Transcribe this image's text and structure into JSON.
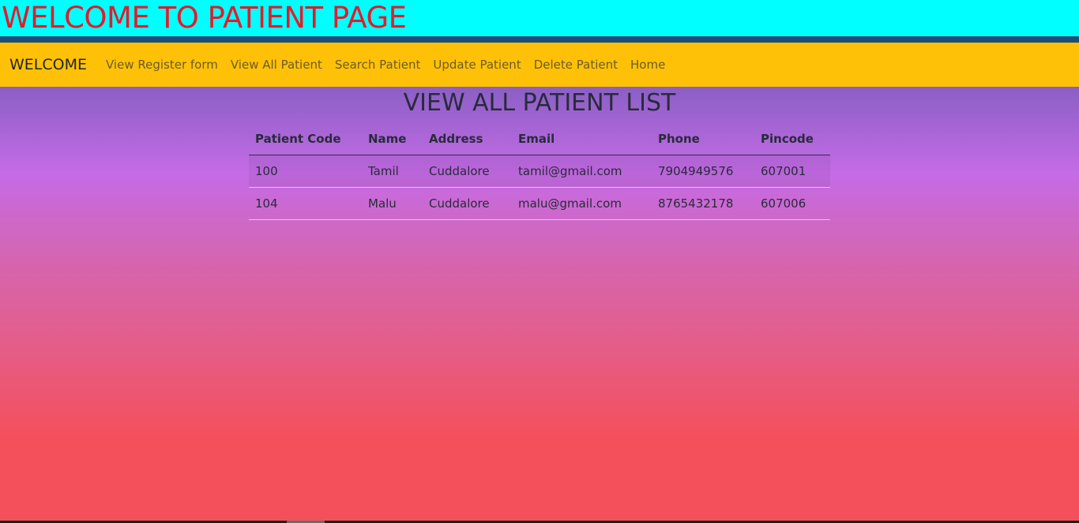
{
  "header": {
    "title": "WELCOME TO PATIENT PAGE",
    "bg_color": "#00ffff",
    "title_color": "#e11d2b"
  },
  "navbar": {
    "brand": "WELCOME",
    "bg_color": "#ffc107",
    "links": [
      {
        "label": "View Register form"
      },
      {
        "label": "View All Patient"
      },
      {
        "label": "Search Patient"
      },
      {
        "label": "Update Patient"
      },
      {
        "label": "Delete Patient"
      },
      {
        "label": "Home"
      }
    ]
  },
  "main": {
    "title": "VIEW ALL PATIENT LIST",
    "table": {
      "columns": [
        "Patient Code",
        "Name",
        "Address",
        "Email",
        "Phone",
        "Pincode"
      ],
      "rows": [
        [
          "100",
          "Tamil",
          "Cuddalore",
          "tamil@gmail.com",
          "7904949576",
          "607001"
        ],
        [
          "104",
          "Malu",
          "Cuddalore",
          "malu@gmail.com",
          "8765432178",
          "607006"
        ]
      ]
    }
  }
}
